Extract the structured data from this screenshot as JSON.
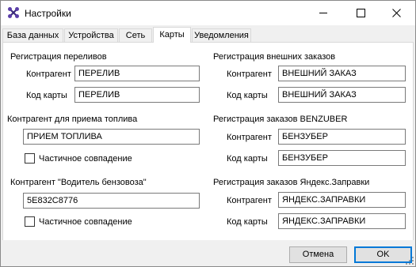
{
  "window": {
    "title": "Настройки",
    "icon": "app-logo-icon",
    "controls": {
      "minimize": "minimize-icon",
      "maximize": "maximize-icon",
      "close": "close-icon"
    }
  },
  "tabs": [
    {
      "label": "База данных",
      "active": false
    },
    {
      "label": "Устройства",
      "active": false
    },
    {
      "label": "Сеть",
      "active": false
    },
    {
      "label": "Карты",
      "active": true
    },
    {
      "label": "Уведомления",
      "active": false
    }
  ],
  "overflow_registration": {
    "title": "Регистрация переливов",
    "contractor_label": "Контрагент",
    "contractor_value": "ПЕРЕЛИВ",
    "card_label": "Код карты",
    "card_value": "ПЕРЕЛИВ"
  },
  "fuel_receipt": {
    "title": "Контрагент для приема топлива",
    "value": "ПРИЕМ ТОПЛИВА",
    "partial_match_label": "Частичное совпадение",
    "partial_match_checked": false
  },
  "tanker_driver": {
    "title": "Контрагент \"Водитель бензовоза\"",
    "value": "5E832C8776",
    "partial_match_label": "Частичное совпадение",
    "partial_match_checked": false
  },
  "external_orders": {
    "title": "Регистрация внешних заказов",
    "contractor_label": "Контрагент",
    "contractor_value": "ВНЕШНИЙ ЗАКАЗ",
    "card_label": "Код карты",
    "card_value": "ВНЕШНИЙ ЗАКАЗ"
  },
  "benzuber_orders": {
    "title": "Регистрация заказов BENZUBER",
    "contractor_label": "Контрагент",
    "contractor_value": "БЕНЗУБЕР",
    "card_label": "Код карты",
    "card_value": "БЕНЗУБЕР"
  },
  "yandex_orders": {
    "title": "Регистрация заказов Яндекс.Заправки",
    "contractor_label": "Контрагент",
    "contractor_value": "ЯНДЕКС.ЗАПРАВКИ",
    "card_label": "Код карты",
    "card_value": "ЯНДЕКС.ЗАПРАВКИ"
  },
  "buttons": {
    "cancel": "Отмена",
    "ok": "OK"
  },
  "colors": {
    "accent": "#0078d7",
    "window_bg": "#f0f0f0",
    "panel_bg": "#ffffff"
  }
}
